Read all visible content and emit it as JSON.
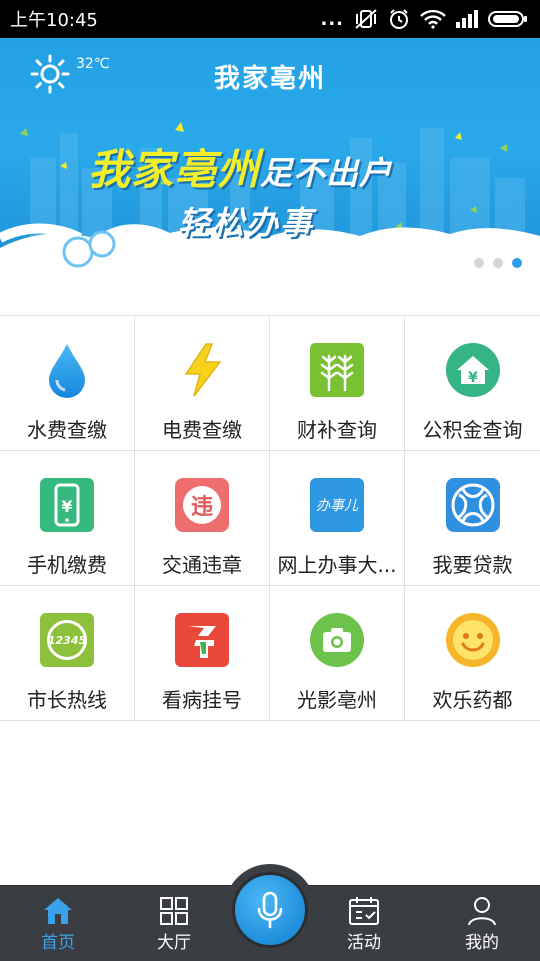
{
  "status_bar": {
    "time": "上午10:45",
    "dots": "..."
  },
  "banner": {
    "weather_icon": "sun-icon",
    "temperature": "32℃",
    "title": "我家亳州",
    "slogan_main": "我家亳州",
    "slogan_tail": "足不出户",
    "slogan_sub": "轻松办事",
    "carousel_count": 3,
    "carousel_active_index": 3
  },
  "services": [
    {
      "label": "水费查缴",
      "icon": "water-drop-icon"
    },
    {
      "label": "电费查缴",
      "icon": "lightning-icon"
    },
    {
      "label": "财补查询",
      "icon": "wheat-icon"
    },
    {
      "label": "公积金查询",
      "icon": "house-yuan-icon"
    },
    {
      "label": "手机缴费",
      "icon": "phone-yuan-icon"
    },
    {
      "label": "交通违章",
      "icon": "violation-icon"
    },
    {
      "label": "网上办事大...",
      "icon": "banshi-icon"
    },
    {
      "label": "我要贷款",
      "icon": "loan-icon"
    },
    {
      "label": "市长热线",
      "icon": "hotline-12345-icon"
    },
    {
      "label": "看病挂号",
      "icon": "hospital-cross-icon"
    },
    {
      "label": "光影亳州",
      "icon": "camera-icon"
    },
    {
      "label": "欢乐药都",
      "icon": "smiley-icon"
    }
  ],
  "icon_texts": {
    "violation": "违",
    "banshi": "办事儿",
    "hotline": "12345"
  },
  "tabs": [
    {
      "label": "首页",
      "icon": "home-icon",
      "active": true
    },
    {
      "label": "大厅",
      "icon": "grid-icon",
      "active": false
    },
    {
      "label": "活动",
      "icon": "calendar-icon",
      "active": false
    },
    {
      "label": "我的",
      "icon": "user-icon",
      "active": false
    }
  ],
  "voice_button": {
    "icon": "microphone-icon"
  },
  "colors": {
    "accent": "#3aa2ec",
    "banner_blue": "#2aa9ea",
    "tabbar": "#3a3d42",
    "slogan_yellow": "#f3ee2a"
  }
}
